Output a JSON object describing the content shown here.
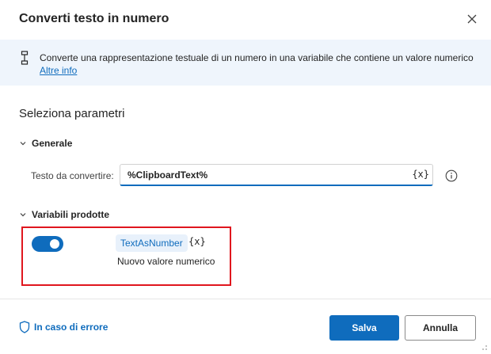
{
  "dialog": {
    "title": "Converti testo in numero",
    "close_icon": "close-icon"
  },
  "info": {
    "icon": "convert-action-icon",
    "text": "Converte una rappresentazione testuale di un numero in una variabile che contiene un valore numerico",
    "link": "Altre info"
  },
  "params": {
    "section_title": "Seleziona parametri",
    "general_label": "Generale",
    "input_label": "Testo da convertire:",
    "input_value": "%ClipboardText%",
    "var_button": "{x}",
    "help_icon": "info-circle-icon"
  },
  "produced": {
    "label": "Variabili prodotte",
    "toggle_on": true,
    "variable_name": "TextAsNumber",
    "var_button": "{x}",
    "description": "Nuovo valore numerico"
  },
  "footer": {
    "error_link": "In caso di errore",
    "save_label": "Salva",
    "cancel_label": "Annulla"
  },
  "colors": {
    "accent": "#0f6cbd",
    "highlight": "#e0161e",
    "info_bg": "#eff5fc"
  }
}
